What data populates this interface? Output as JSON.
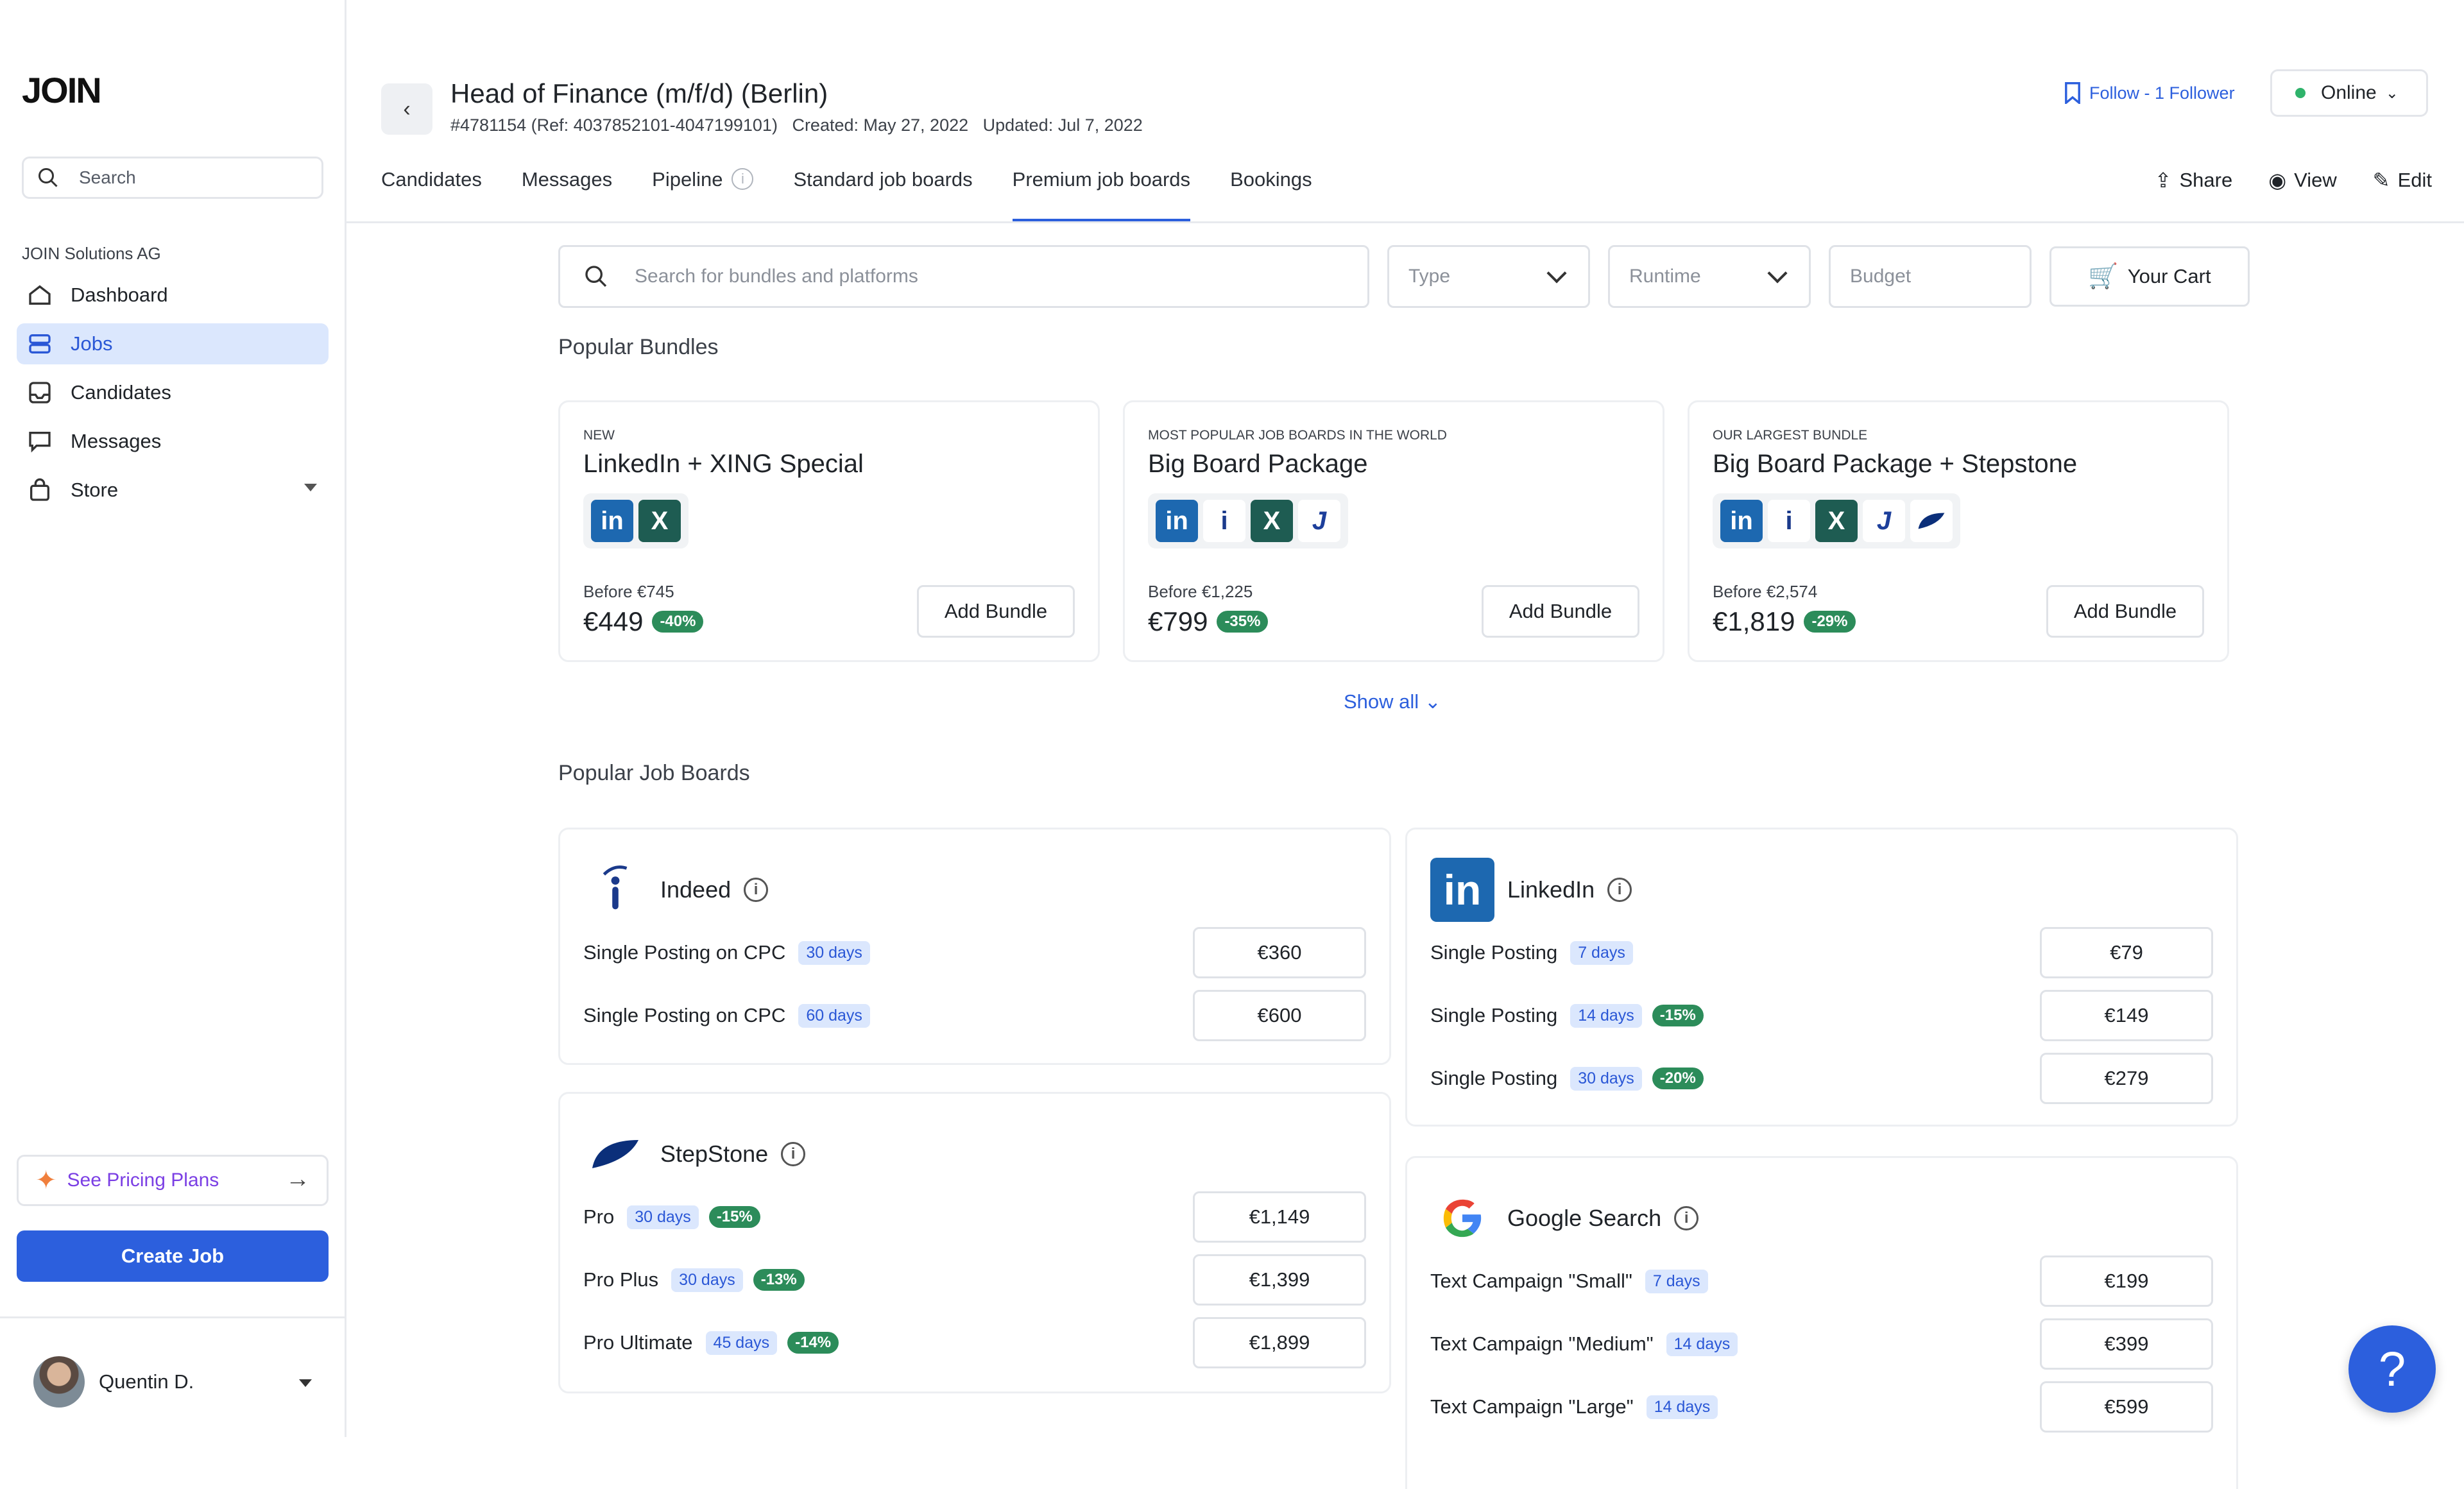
{
  "app": {
    "logo": "JOIN"
  },
  "sidebar": {
    "search_placeholder": "Search",
    "org": "JOIN Solutions AG",
    "items": [
      {
        "label": "Dashboard",
        "icon": "home-icon"
      },
      {
        "label": "Jobs",
        "icon": "jobs-icon",
        "active": true
      },
      {
        "label": "Candidates",
        "icon": "inbox-icon"
      },
      {
        "label": "Messages",
        "icon": "message-icon"
      },
      {
        "label": "Store",
        "icon": "bag-icon"
      }
    ],
    "pricing_label": "See Pricing Plans",
    "create_label": "Create Job",
    "user_name": "Quentin D."
  },
  "header": {
    "title": "Head of Finance (m/f/d) (Berlin)",
    "meta": "#4781154 (Ref: 4037852101-4047199101)   Created: May 27, 2022   Updated: Jul 7, 2022",
    "follow": "Follow - 1 Follower",
    "status": "Online",
    "tabs": [
      "Candidates",
      "Messages",
      "Pipeline",
      "Standard job boards",
      "Premium job boards",
      "Bookings"
    ],
    "active_tab": "Premium job boards",
    "actions": [
      "Share",
      "View",
      "Edit"
    ]
  },
  "filters": {
    "search_placeholder": "Search for bundles and platforms",
    "type": "Type",
    "runtime": "Runtime",
    "budget": "Budget",
    "cart": "Your Cart"
  },
  "bundles_section": {
    "title": "Popular Bundles",
    "show_all": "Show all",
    "items": [
      {
        "kicker": "NEW",
        "name": "LinkedIn + XING Special",
        "logos": [
          "linkedin",
          "xing"
        ],
        "before": "Before €745",
        "price": "€449",
        "discount": "-40%",
        "cta": "Add Bundle"
      },
      {
        "kicker": "MOST POPULAR JOB BOARDS IN THE WORLD",
        "name": "Big Board Package",
        "logos": [
          "linkedin",
          "indeed",
          "xing",
          "jobup"
        ],
        "before": "Before €1,225",
        "price": "€799",
        "discount": "-35%",
        "cta": "Add Bundle"
      },
      {
        "kicker": "OUR LARGEST BUNDLE",
        "name": "Big Board Package + Stepstone",
        "logos": [
          "linkedin",
          "indeed",
          "xing",
          "jobup",
          "stepstone"
        ],
        "before": "Before €2,574",
        "price": "€1,819",
        "discount": "-29%",
        "cta": "Add Bundle"
      }
    ]
  },
  "boards_section": {
    "title": "Popular Job Boards",
    "boards": {
      "indeed": {
        "name": "Indeed",
        "rows": [
          {
            "label": "Single Posting on CPC",
            "days": "30 days",
            "price": "€360"
          },
          {
            "label": "Single Posting on CPC",
            "days": "60 days",
            "price": "€600"
          }
        ]
      },
      "linkedin": {
        "name": "LinkedIn",
        "rows": [
          {
            "label": "Single Posting",
            "days": "7 days",
            "price": "€79"
          },
          {
            "label": "Single Posting",
            "days": "14 days",
            "discount": "-15%",
            "price": "€149"
          },
          {
            "label": "Single Posting",
            "days": "30 days",
            "discount": "-20%",
            "price": "€279"
          }
        ]
      },
      "stepstone": {
        "name": "StepStone",
        "rows": [
          {
            "label": "Pro",
            "days": "30 days",
            "discount": "-15%",
            "price": "€1,149"
          },
          {
            "label": "Pro Plus",
            "days": "30 days",
            "discount": "-13%",
            "price": "€1,399"
          },
          {
            "label": "Pro Ultimate",
            "days": "45 days",
            "discount": "-14%",
            "price": "€1,899"
          }
        ]
      },
      "google": {
        "name": "Google Search",
        "rows": [
          {
            "label": "Text Campaign \"Small\"",
            "days": "7 days",
            "price": "€199"
          },
          {
            "label": "Text Campaign \"Medium\"",
            "days": "14 days",
            "price": "€399"
          },
          {
            "label": "Text Campaign \"Large\"",
            "days": "14 days",
            "price": "€599"
          }
        ]
      }
    }
  },
  "help_label": "?"
}
